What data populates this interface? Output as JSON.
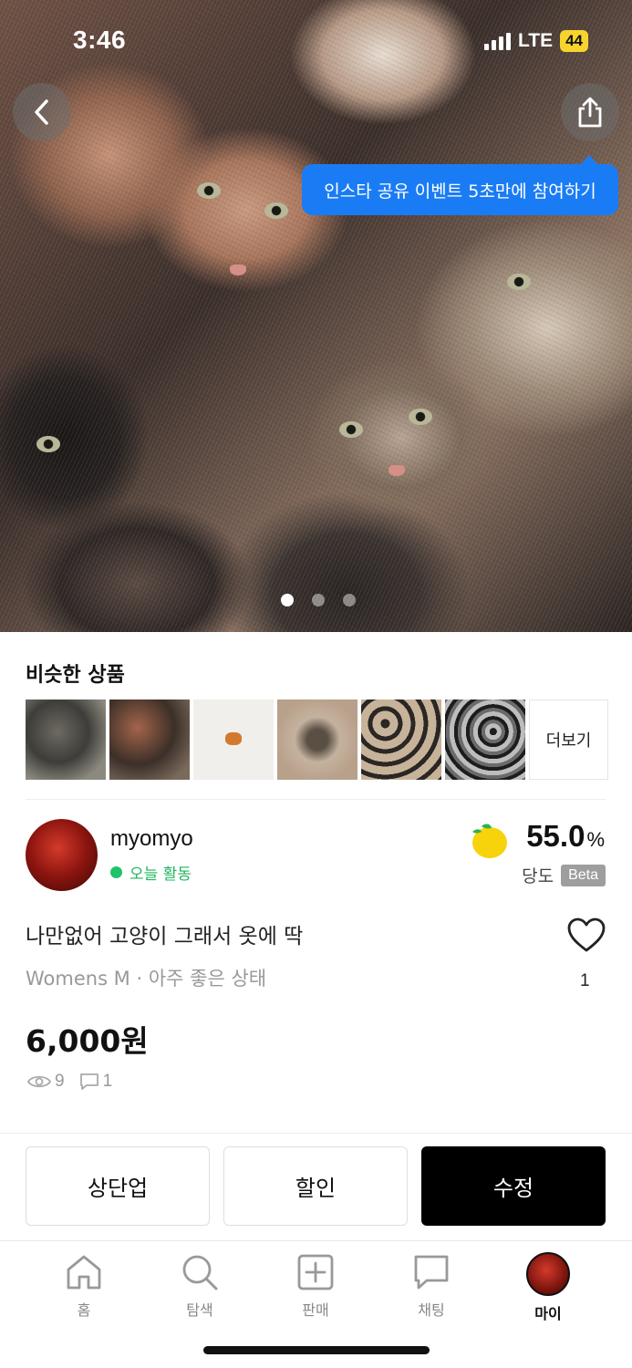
{
  "status_bar": {
    "time": "3:46",
    "network": "LTE",
    "battery": "44"
  },
  "hero": {
    "tooltip": "인스타 공유 이벤트 5초만에 참여하기",
    "image_count": 3,
    "current_image": 1
  },
  "similar": {
    "title": "비슷한 상품",
    "more_label": "더보기"
  },
  "seller": {
    "name": "myomyo",
    "activity": "오늘 활동",
    "score_value": "55.0",
    "score_unit": "%",
    "score_label": "당도",
    "beta_label": "Beta"
  },
  "product": {
    "title": "나만없어 고양이 그래서 옷에 딱",
    "meta": "Womens M · 아주 좋은 상태",
    "likes": "1",
    "price": "6,000원",
    "views": "9",
    "comments": "1"
  },
  "actions": {
    "bump": "상단업",
    "discount": "할인",
    "edit": "수정"
  },
  "tabbar": {
    "home": "홈",
    "explore": "탐색",
    "sell": "판매",
    "chat": "채팅",
    "my": "마이"
  },
  "colors": {
    "tooltip_blue": "#1a7cf5",
    "active_green": "#1fc36a",
    "lemon": "#f7d30b"
  }
}
